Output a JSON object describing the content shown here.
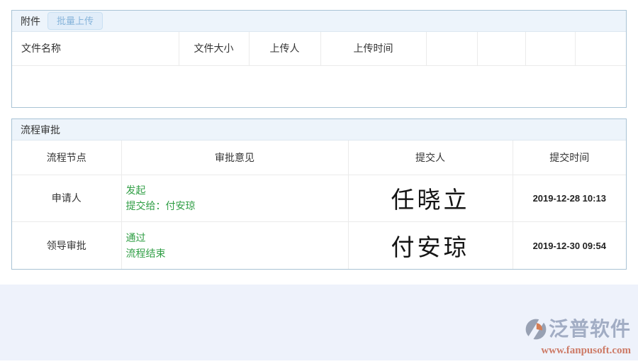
{
  "colors": {
    "panel_border": "#a9c3d5",
    "panel_header_bg": "#edf4fb",
    "table_line": "#ebebeb",
    "status_green": "#2f9e44",
    "button_bg": "#e1edf9",
    "button_border": "#c9e0f2",
    "button_text": "#86b4da",
    "footer_bg": "#eef2fb",
    "brand_text": "#a2adc4",
    "brand_url_text": "#cd7a66",
    "logo_gray": "#98a1b3",
    "logo_orange": "#d57e55"
  },
  "attachments": {
    "title": "附件",
    "upload_button": "批量上传",
    "columns": [
      "文件名称",
      "文件大小",
      "上传人",
      "上传时间",
      "",
      "",
      "",
      ""
    ],
    "rows": []
  },
  "approval": {
    "title": "流程审批",
    "columns": [
      "流程节点",
      "审批意见",
      "提交人",
      "提交时间"
    ],
    "rows": [
      {
        "node": "申请人",
        "opinion_line1": "发起",
        "opinion_line2": "提交给：付安琼",
        "signature": "任晓立",
        "time": "2019-12-28 10:13"
      },
      {
        "node": "领导审批",
        "opinion_line1": "通过",
        "opinion_line2": "流程结束",
        "signature": "付安琼",
        "time": "2019-12-30 09:54"
      }
    ]
  },
  "footer": {
    "brand": "泛普软件",
    "url": "www.fanpusoft.com"
  }
}
